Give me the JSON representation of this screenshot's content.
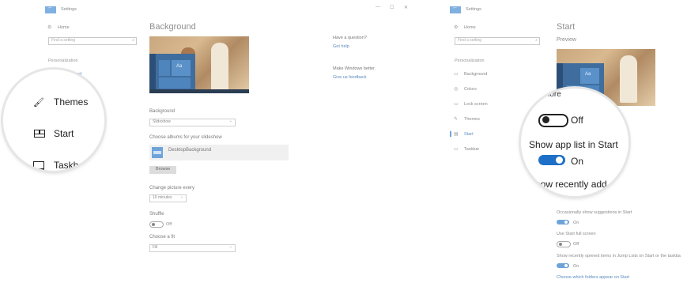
{
  "colors": {
    "accent": "#6ea3da",
    "accent_strong": "#1e6fc7",
    "text_dark": "#222222"
  },
  "left": {
    "window_title": "Settings",
    "home": "Home",
    "search_placeholder": "Find a setting",
    "section": "Personalization",
    "nav_selected": "Background",
    "page_title": "Background",
    "background_label": "Background",
    "background_value": "Slideshow",
    "albums_label": "Choose albums for your slideshow",
    "album_name": "DesktopBackground",
    "browse": "Browse",
    "change_label": "Change picture every",
    "change_value": "10 minutes",
    "shuffle_label": "Shuffle",
    "shuffle_state": "Off",
    "fit_label": "Choose a fit",
    "fit_value": "Fill",
    "preview_tile": "Aa",
    "magnifier": {
      "items": [
        {
          "label": "Themes",
          "icon": "themes-icon"
        },
        {
          "label": "Start",
          "icon": "start-icon"
        },
        {
          "label": "Taskbar",
          "icon": "taskbar-icon"
        }
      ]
    }
  },
  "right": {
    "window_title": "Settings",
    "window_controls": {
      "minimize": "—",
      "maximize": "☐",
      "close": "✕"
    },
    "question": "Have a question?",
    "get_help": "Get help",
    "better": "Make Windows better.",
    "feedback": "Give us feedback",
    "home": "Home",
    "search_placeholder": "Find a setting",
    "section": "Personalization",
    "nav": [
      {
        "label": "Background",
        "icon": "image-icon"
      },
      {
        "label": "Colors",
        "icon": "palette-icon"
      },
      {
        "label": "Lock screen",
        "icon": "lock-screen-icon"
      },
      {
        "label": "Themes",
        "icon": "themes-icon"
      },
      {
        "label": "Start",
        "icon": "start-icon"
      },
      {
        "label": "Taskbar",
        "icon": "taskbar-icon"
      }
    ],
    "page_title": "Start",
    "preview_label": "Preview",
    "preview_tile": "Aa",
    "magnifier": {
      "partial_top": "more",
      "toggle1_state": "Off",
      "app_list_label": "Show app list in Start",
      "toggle2_state": "On",
      "recently_label": "Show recently add",
      "toggle3_state": "On"
    },
    "suggestions_label": "Occasionally show suggestions in Start",
    "suggestions_state": "On",
    "fullscreen_label": "Use Start full screen",
    "fullscreen_state": "Off",
    "jumplists_label": "Show recently opened items in Jump Lists on Start or the taskba",
    "jumplists_state": "On",
    "folders_link": "Choose which folders appear on Start"
  }
}
